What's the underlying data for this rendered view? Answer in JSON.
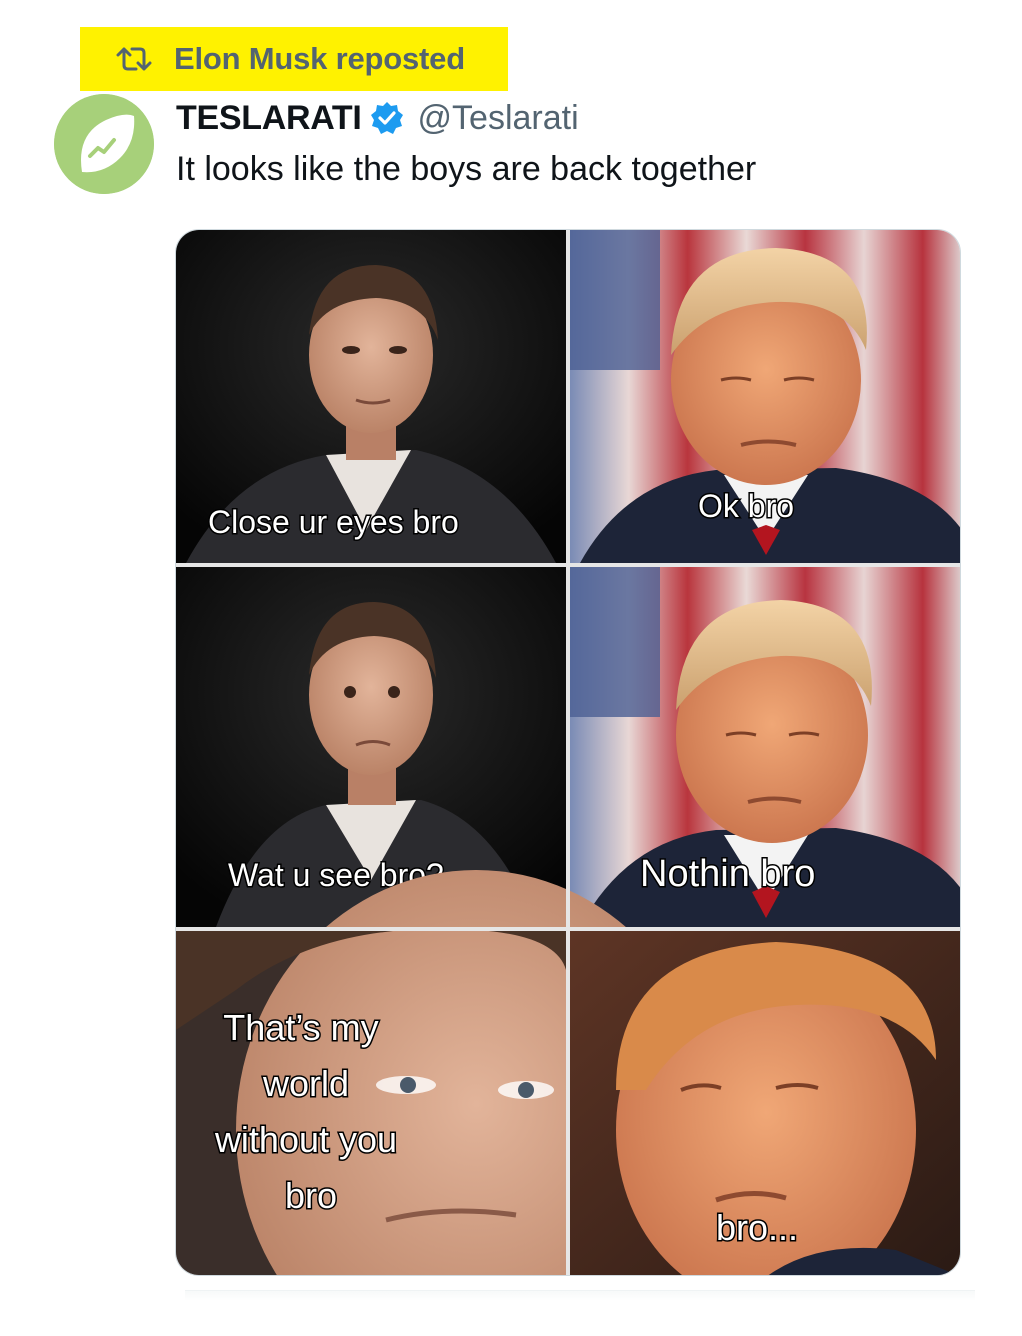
{
  "repost": {
    "label": "Elon Musk reposted",
    "icon": "repost-icon",
    "highlight_color": "#fff200"
  },
  "tweet": {
    "display_name": "TESLARATI",
    "verified": true,
    "verified_icon": "verified-badge-icon",
    "handle": "@Teslarati",
    "text": "It looks like the boys are back together",
    "avatar_icon": "teslarati-leaf-logo"
  },
  "meme": {
    "panels": [
      {
        "caption": "Close ur eyes bro"
      },
      {
        "caption": "Ok bro"
      },
      {
        "caption": "Wat u see bro?"
      },
      {
        "caption": "Nothin bro"
      },
      {
        "caption_lines": [
          "That’s my",
          "world",
          "without you",
          "bro"
        ]
      },
      {
        "caption": "bro..."
      }
    ]
  },
  "colors": {
    "text_primary": "#0f1419",
    "text_secondary": "#536471",
    "verified_blue": "#1d9bf0",
    "avatar_green": "#a7d07a"
  }
}
